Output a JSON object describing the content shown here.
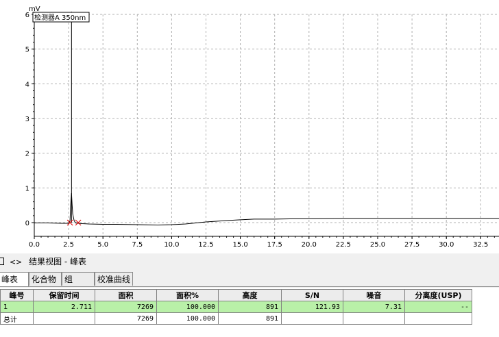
{
  "chart": {
    "y_unit": "mV",
    "detector_label": "检测器A 350nm"
  },
  "chart_data": {
    "type": "line",
    "title": "",
    "xlabel": "",
    "ylabel": "mV",
    "xlim": [
      0,
      36
    ],
    "ylim": [
      -0.3,
      6
    ],
    "x_ticks": [
      "0.0",
      "2.5",
      "5.0",
      "7.5",
      "10.0",
      "12.5",
      "15.0",
      "17.5",
      "20.0",
      "22.5",
      "25.0",
      "27.5",
      "30.0",
      "32.5"
    ],
    "y_ticks": [
      "0",
      "1",
      "2",
      "3",
      "4",
      "5",
      "6"
    ],
    "grid": true,
    "series": [
      {
        "name": "",
        "x": [
          0,
          1,
          2,
          2.5,
          2.6,
          2.65,
          2.711,
          2.75,
          2.8,
          2.9,
          3.0,
          3.2,
          3.5,
          4,
          5,
          6,
          7.5,
          9,
          10,
          11,
          12,
          12.5,
          14,
          15,
          16,
          17.5,
          19,
          20,
          22.5,
          25,
          27.5,
          30,
          32.5,
          36
        ],
        "y": [
          -0.01,
          -0.01,
          -0.02,
          -0.02,
          0.05,
          0.5,
          0.85,
          0.55,
          0.25,
          0.06,
          -0.01,
          -0.02,
          -0.03,
          -0.04,
          -0.05,
          -0.05,
          -0.06,
          -0.07,
          -0.06,
          -0.04,
          0.0,
          0.02,
          0.06,
          0.08,
          0.1,
          0.1,
          0.11,
          0.11,
          0.12,
          0.12,
          0.12,
          0.12,
          0.12,
          0.12
        ]
      }
    ],
    "annotations": [
      {
        "type": "vertical_line",
        "x": 2.711
      },
      {
        "type": "integration_marker",
        "x": 2.6
      },
      {
        "type": "integration_marker",
        "x": 3.2
      }
    ]
  },
  "results_view": {
    "title": "结果视图 -  峰表"
  },
  "tabs": [
    {
      "label": "峰表",
      "active": true
    },
    {
      "label": "化合物",
      "active": false
    },
    {
      "label": "组",
      "active": false
    },
    {
      "label": "校准曲线",
      "active": false
    }
  ],
  "peak_table": {
    "columns": [
      "峰号",
      "保留时间",
      "面积",
      "面积%",
      "高度",
      "S/N",
      "噪音",
      "分离度(USP)"
    ],
    "rows": [
      {
        "cells": [
          "1",
          "2.711",
          "7269",
          "100.000",
          "891",
          "121.93",
          "7.31",
          "--"
        ],
        "selected": true
      },
      {
        "cells": [
          "总计",
          "",
          "7269",
          "100.000",
          "891",
          "",
          "",
          ""
        ],
        "selected": false
      }
    ]
  }
}
